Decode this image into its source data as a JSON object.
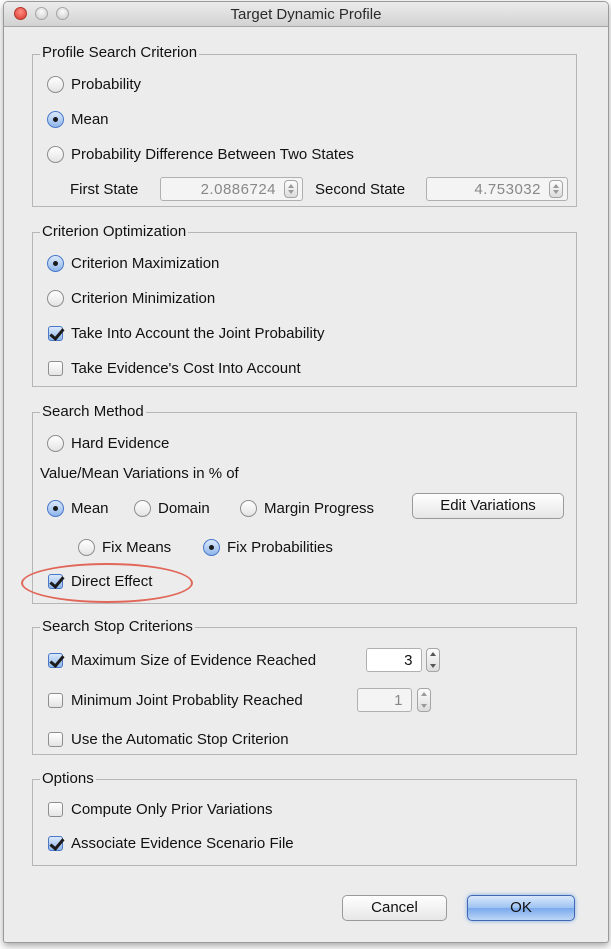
{
  "window": {
    "title": "Target Dynamic Profile"
  },
  "profile_search": {
    "legend": "Profile Search Criterion",
    "probability": "Probability",
    "mean": "Mean",
    "prob_diff": "Probability Difference Between Two States",
    "first_state_label": "First State",
    "first_state_value": "2.0886724",
    "second_state_label": "Second State",
    "second_state_value": "4.753032",
    "selected": "Mean"
  },
  "criterion_optimization": {
    "legend": "Criterion Optimization",
    "maximization": "Criterion Maximization",
    "minimization": "Criterion Minimization",
    "joint_probability": "Take Into Account the Joint Probability",
    "evidence_cost": "Take Evidence's Cost Into Account",
    "selected": "Criterion Maximization",
    "joint_probability_checked": true,
    "evidence_cost_checked": false
  },
  "search_method": {
    "legend": "Search Method",
    "hard_evidence": "Hard Evidence",
    "variations_label": "Value/Mean Variations in % of",
    "mean": "Mean",
    "domain": "Domain",
    "margin_progress": "Margin Progress",
    "edit_variations": "Edit Variations",
    "fix_means": "Fix Means",
    "fix_probabilities": "Fix Probabilities",
    "direct_effect": "Direct Effect",
    "variation_selected": "Mean",
    "fix_selected": "Fix Probabilities",
    "direct_effect_checked": true,
    "highlight_color": "#e0675a"
  },
  "stop_criterions": {
    "legend": "Search Stop Criterions",
    "max_size": "Maximum Size of Evidence Reached",
    "max_size_value": "3",
    "min_joint": "Minimum Joint Probablity Reached",
    "min_joint_value": "1",
    "automatic": "Use the Automatic Stop Criterion",
    "max_size_checked": true,
    "min_joint_checked": false,
    "automatic_checked": false
  },
  "options": {
    "legend": "Options",
    "prior_only": "Compute Only Prior Variations",
    "associate": "Associate Evidence Scenario File",
    "prior_only_checked": false,
    "associate_checked": true
  },
  "buttons": {
    "cancel": "Cancel",
    "ok": "OK"
  },
  "colors": {
    "window_bg": "#ececec",
    "accent": "#4a78c9",
    "ok_button": "#7aa9ec"
  }
}
